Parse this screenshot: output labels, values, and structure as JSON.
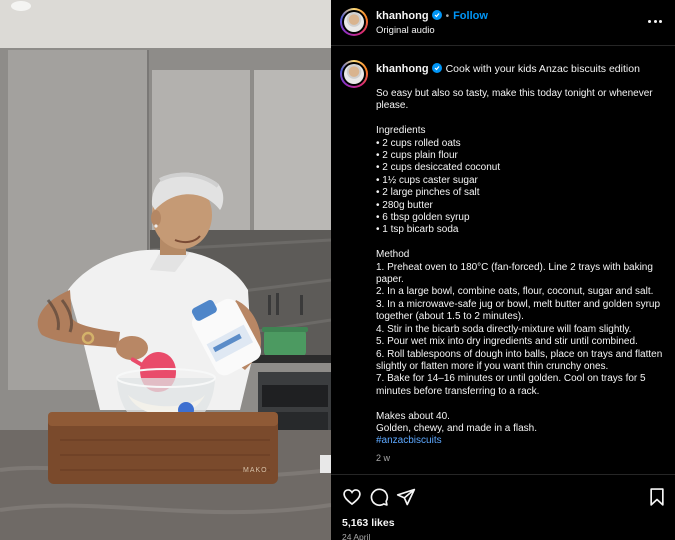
{
  "post": {
    "username": "khanhong",
    "follow_label": "Follow",
    "audio_label": "Original audio",
    "caption_title": "Cook with your kids Anzac biscuits edition",
    "caption_lines": [
      "So easy but also so tasty, make this today tonight or whenever",
      "please.",
      "",
      "Ingredients",
      "• 2 cups rolled oats",
      "• 2 cups plain flour",
      "• 2 cups desiccated coconut",
      "• 1½ cups caster sugar",
      "• 2 large pinches of salt",
      "• 280g butter",
      "• 6 tbsp golden syrup",
      "• 1 tsp bicarb soda",
      "",
      "Method",
      "1. Preheat oven to 180°C (fan-forced). Line 2 trays with baking",
      "paper.",
      "2. In a large bowl, combine oats, flour, coconut, sugar and salt.",
      "3. In a microwave-safe jug or bowl, melt butter and golden syrup",
      "together (about 1.5 to 2 minutes).",
      "4. Stir in the bicarb soda directly-mixture will foam slightly.",
      "5. Pour wet mix into dry ingredients and stir until combined.",
      "6. Roll tablespoons of dough into balls, place on trays and flatten",
      "slightly or flatten more if you want thin crunchy ones.",
      "7. Bake for 14–16 minutes or until golden. Cool on trays for 5",
      "minutes before transferring to a rack.",
      "",
      "Makes about 40.",
      "Golden, chewy, and made in a flash."
    ],
    "hashtag": "#anzacbiscuits",
    "time_ago": "2 w",
    "likes": "5,163 likes",
    "date": "24 April",
    "icons": {
      "more": "more-options-icon",
      "like": "heart-icon",
      "comment": "comment-icon",
      "share": "share-icon",
      "save": "bookmark-icon"
    },
    "colors": {
      "accent": "#0095f6",
      "background": "#000000",
      "text": "#f5f5f5",
      "muted": "#a8a8a8"
    }
  },
  "media": {
    "board_brand": "MAKO"
  }
}
